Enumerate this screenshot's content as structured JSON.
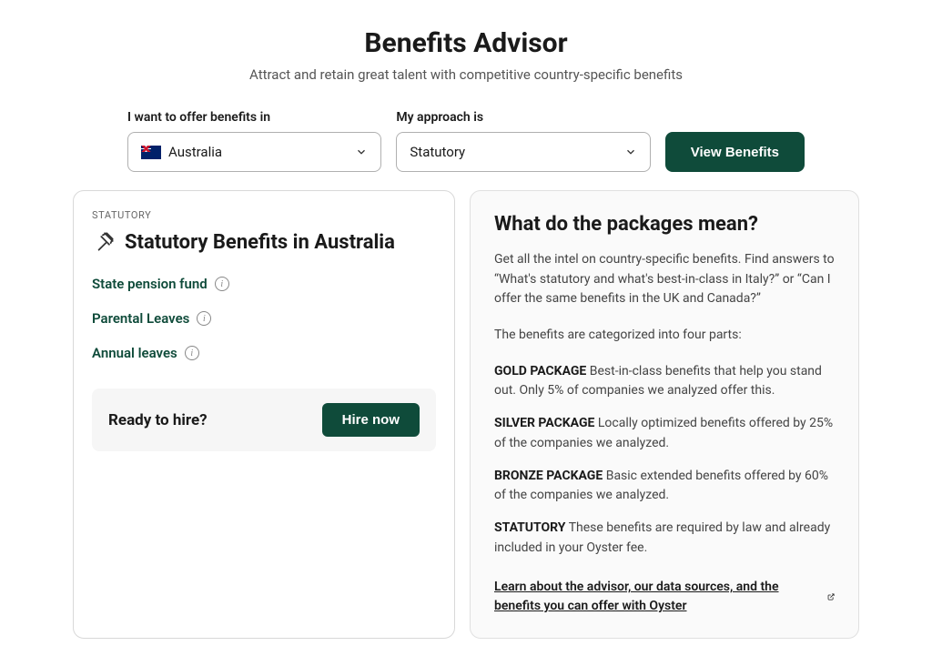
{
  "header": {
    "title": "Benefits Advisor",
    "subtitle": "Attract and retain great talent with competitive country-specific benefits"
  },
  "filters": {
    "country_label": "I want to offer benefits in",
    "country_value": "Australia",
    "approach_label": "My approach is",
    "approach_value": "Statutory",
    "view_button": "View Benefits"
  },
  "results": {
    "tag": "STATUTORY",
    "title": "Statutory Benefits in Australia",
    "items": [
      "State pension fund",
      "Parental Leaves",
      "Annual leaves"
    ],
    "hire_prompt": "Ready to hire?",
    "hire_button": "Hire now"
  },
  "info": {
    "title": "What do the packages mean?",
    "intro": "Get all the intel on country-specific benefits. Find answers to “What's statutory and what's best-in-class in Italy?” or “Can I offer the same benefits in the UK and Canada?”",
    "categories_intro": "The benefits are categorized into four parts:",
    "packages": [
      {
        "name": "GOLD PACKAGE",
        "desc": "Best-in-class benefits that help you stand out. Only 5% of companies we analyzed offer this."
      },
      {
        "name": "SILVER PACKAGE",
        "desc": "Locally optimized benefits offered by 25% of the companies we analyzed."
      },
      {
        "name": "BRONZE PACKAGE",
        "desc": "Basic extended benefits offered by 60% of the companies we analyzed."
      },
      {
        "name": "STATUTORY",
        "desc": "These benefits are required by law and already included in your Oyster fee."
      }
    ],
    "learn_link": "Learn about the advisor, our data sources, and the benefits you can offer with Oyster"
  }
}
